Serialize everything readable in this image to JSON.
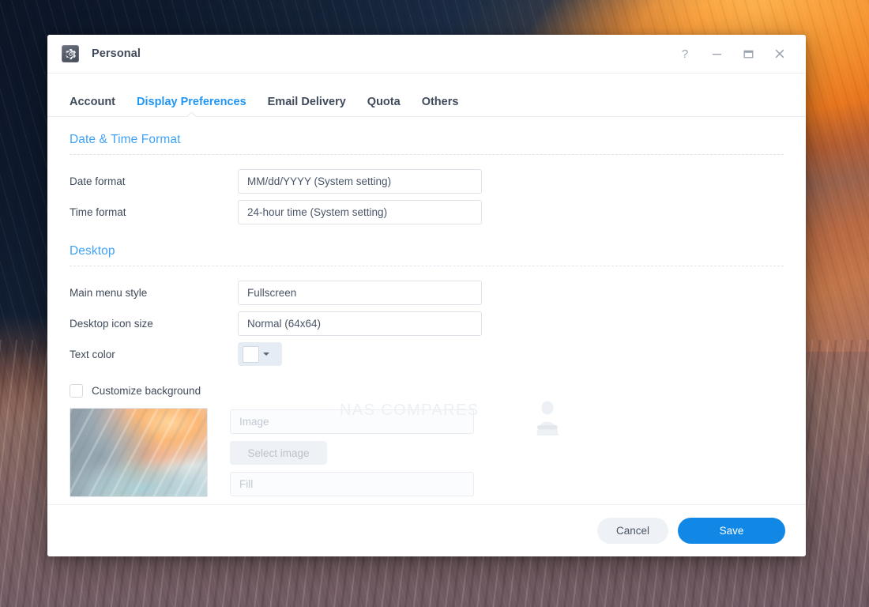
{
  "window": {
    "title": "Personal",
    "app_icon": "gear-icon",
    "controls": {
      "help": "?",
      "minimize": "–",
      "maximize": "□",
      "close": "×"
    }
  },
  "tabs": [
    {
      "label": "Account",
      "active": false
    },
    {
      "label": "Display Preferences",
      "active": true
    },
    {
      "label": "Email Delivery",
      "active": false
    },
    {
      "label": "Quota",
      "active": false
    },
    {
      "label": "Others",
      "active": false
    }
  ],
  "sections": {
    "datetime": {
      "title": "Date & Time Format",
      "date_format": {
        "label": "Date format",
        "value": "MM/dd/YYYY (System setting)"
      },
      "time_format": {
        "label": "Time format",
        "value": "24-hour time (System setting)"
      }
    },
    "desktop": {
      "title": "Desktop",
      "main_menu_style": {
        "label": "Main menu style",
        "value": "Fullscreen"
      },
      "icon_size": {
        "label": "Desktop icon size",
        "value": "Normal (64x64)"
      },
      "text_color": {
        "label": "Text color",
        "value": "#ffffff"
      },
      "customize_background": {
        "label": "Customize background",
        "checked": false
      },
      "background_type": {
        "value": "Image",
        "disabled": true
      },
      "select_image_button": {
        "label": "Select image",
        "disabled": true
      },
      "background_fit": {
        "value": "Fill",
        "disabled": true
      }
    }
  },
  "footer": {
    "cancel_label": "Cancel",
    "save_label": "Save"
  },
  "watermark": {
    "text": "NAS COMPARES"
  },
  "colors": {
    "accent": "#2196f3",
    "section_heading": "#3fa2f7",
    "save_button": "#1188e6",
    "text": "#3f4a5a"
  }
}
